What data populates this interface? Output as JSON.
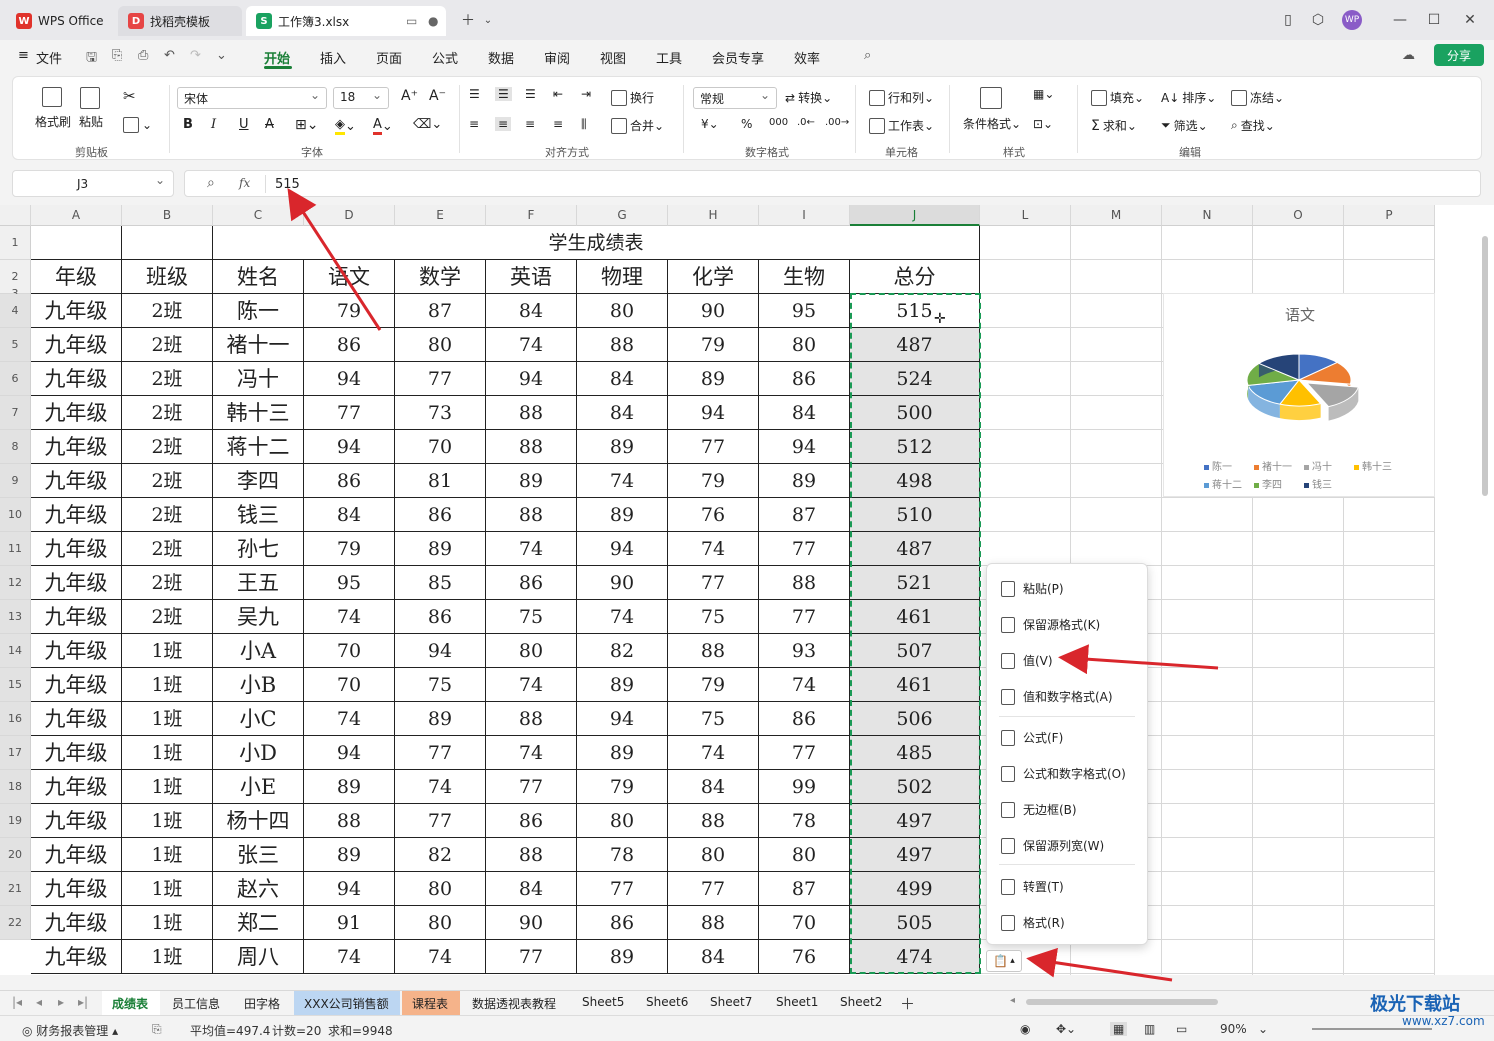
{
  "tabs": [
    {
      "label": "WPS Office",
      "icon": "wps-logo-icon"
    },
    {
      "label": "找稻壳模板",
      "icon": "docer-logo-icon"
    },
    {
      "label": "工作簿3.xlsx",
      "icon": "sheet-logo-icon"
    }
  ],
  "menu": {
    "file": "文件",
    "items": [
      "开始",
      "插入",
      "页面",
      "公式",
      "数据",
      "审阅",
      "视图",
      "工具",
      "会员专享",
      "效率"
    ],
    "active": "开始",
    "share": "分享"
  },
  "ribbon": {
    "clipboard": {
      "format_painter": "格式刷",
      "paste": "粘贴",
      "label": "剪贴板"
    },
    "font": {
      "name": "宋体",
      "size": "18",
      "label": "字体"
    },
    "align": {
      "wrap": "换行",
      "merge": "合并",
      "label": "对齐方式"
    },
    "number": {
      "format": "常规",
      "convert": "转换",
      "label": "数字格式"
    },
    "cells": {
      "rowcol": "行和列",
      "sheet": "工作表",
      "label": "单元格"
    },
    "styles": {
      "cond": "条件格式",
      "label": "样式"
    },
    "edit": {
      "fill": "填充",
      "sort": "排序",
      "freeze": "冻结",
      "sum": "求和",
      "filter": "筛选",
      "find": "查找",
      "label": "编辑"
    }
  },
  "formula": {
    "cellref": "J3",
    "fx": "fx",
    "value": "515"
  },
  "columns": [
    "A",
    "B",
    "C",
    "D",
    "E",
    "F",
    "G",
    "H",
    "I",
    "J",
    "L",
    "M",
    "N",
    "O",
    "P"
  ],
  "sheet": {
    "title": "学生成绩表",
    "headers": [
      "年级",
      "班级",
      "姓名",
      "语文",
      "数学",
      "英语",
      "物理",
      "化学",
      "生物",
      "总分"
    ],
    "rows": [
      [
        "九年级",
        "2班",
        "陈一",
        "79",
        "87",
        "84",
        "80",
        "90",
        "95",
        "515"
      ],
      [
        "九年级",
        "2班",
        "褚十一",
        "86",
        "80",
        "74",
        "88",
        "79",
        "80",
        "487"
      ],
      [
        "九年级",
        "2班",
        "冯十",
        "94",
        "77",
        "94",
        "84",
        "89",
        "86",
        "524"
      ],
      [
        "九年级",
        "2班",
        "韩十三",
        "77",
        "73",
        "88",
        "84",
        "94",
        "84",
        "500"
      ],
      [
        "九年级",
        "2班",
        "蒋十二",
        "94",
        "70",
        "88",
        "89",
        "77",
        "94",
        "512"
      ],
      [
        "九年级",
        "2班",
        "李四",
        "86",
        "81",
        "89",
        "74",
        "79",
        "89",
        "498"
      ],
      [
        "九年级",
        "2班",
        "钱三",
        "84",
        "86",
        "88",
        "89",
        "76",
        "87",
        "510"
      ],
      [
        "九年级",
        "2班",
        "孙七",
        "79",
        "89",
        "74",
        "94",
        "74",
        "77",
        "487"
      ],
      [
        "九年级",
        "2班",
        "王五",
        "95",
        "85",
        "86",
        "90",
        "77",
        "88",
        "521"
      ],
      [
        "九年级",
        "2班",
        "吴九",
        "74",
        "86",
        "75",
        "74",
        "75",
        "77",
        "461"
      ],
      [
        "九年级",
        "1班",
        "小A",
        "70",
        "94",
        "80",
        "82",
        "88",
        "93",
        "507"
      ],
      [
        "九年级",
        "1班",
        "小B",
        "70",
        "75",
        "74",
        "89",
        "79",
        "74",
        "461"
      ],
      [
        "九年级",
        "1班",
        "小C",
        "74",
        "89",
        "88",
        "94",
        "75",
        "86",
        "506"
      ],
      [
        "九年级",
        "1班",
        "小D",
        "94",
        "77",
        "74",
        "89",
        "74",
        "77",
        "485"
      ],
      [
        "九年级",
        "1班",
        "小E",
        "89",
        "74",
        "77",
        "79",
        "84",
        "99",
        "502"
      ],
      [
        "九年级",
        "1班",
        "杨十四",
        "88",
        "77",
        "86",
        "80",
        "88",
        "78",
        "497"
      ],
      [
        "九年级",
        "1班",
        "张三",
        "89",
        "82",
        "88",
        "78",
        "80",
        "80",
        "497"
      ],
      [
        "九年级",
        "1班",
        "赵六",
        "94",
        "80",
        "84",
        "77",
        "77",
        "87",
        "499"
      ],
      [
        "九年级",
        "1班",
        "郑二",
        "91",
        "80",
        "90",
        "86",
        "88",
        "70",
        "505"
      ],
      [
        "九年级",
        "1班",
        "周八",
        "74",
        "74",
        "77",
        "89",
        "84",
        "76",
        "474"
      ]
    ]
  },
  "chart": {
    "title": "语文",
    "legend": [
      "陈一",
      "褚十一",
      "冯十",
      "韩十三",
      "蒋十二",
      "李四",
      "钱三"
    ],
    "colors": [
      "#4472c4",
      "#ed7d31",
      "#a5a5a5",
      "#ffc000",
      "#5b9bd5",
      "#70ad47",
      "#264478"
    ]
  },
  "chart_data": {
    "type": "pie",
    "title": "语文",
    "categories": [
      "陈一",
      "褚十一",
      "冯十",
      "韩十三",
      "蒋十二",
      "李四",
      "钱三"
    ],
    "values": [
      79,
      86,
      94,
      77,
      94,
      86,
      84
    ]
  },
  "paste_menu": [
    "粘贴(P)",
    "保留源格式(K)",
    "值(V)",
    "值和数字格式(A)",
    "公式(F)",
    "公式和数字格式(O)",
    "无边框(B)",
    "保留源列宽(W)",
    "转置(T)",
    "格式(R)"
  ],
  "sheet_tabs": [
    "成绩表",
    "员工信息",
    "田字格",
    "XXX公司销售额",
    "课程表",
    "数据透视表教程",
    "Sheet5",
    "Sheet6",
    "Sheet7",
    "Sheet1",
    "Sheet2"
  ],
  "status": {
    "report": "财务报表管理",
    "average": "平均值=497.4",
    "count": "计数=20",
    "sum": "求和=9948",
    "zoom": "90%"
  },
  "watermark": {
    "brand": "极光下载站",
    "url": "www.xz7.com"
  }
}
